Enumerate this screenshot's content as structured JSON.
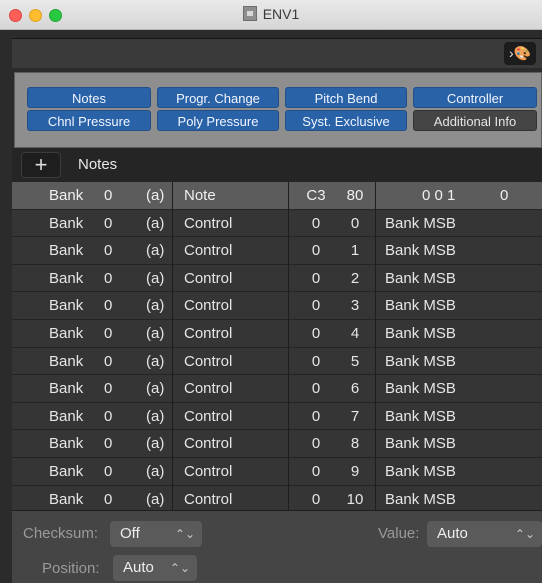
{
  "window": {
    "title": "ENV1"
  },
  "toolbar": {
    "menu_button_label": "›🎨"
  },
  "filters": {
    "buttons": [
      {
        "label": "Notes",
        "active": true
      },
      {
        "label": "Progr. Change",
        "active": true
      },
      {
        "label": "Pitch Bend",
        "active": true
      },
      {
        "label": "Controller",
        "active": true
      },
      {
        "label": "Chnl Pressure",
        "active": true
      },
      {
        "label": "Poly Pressure",
        "active": true
      },
      {
        "label": "Syst. Exclusive",
        "active": true
      },
      {
        "label": "Additional Info",
        "active": false
      }
    ]
  },
  "list": {
    "add_label": "+",
    "type_label": "Notes",
    "header_row": {
      "bank": "Bank",
      "ch": "0",
      "a": "(a)",
      "type": "Note",
      "v1": "C3",
      "v2": "80",
      "info": "0 0 1",
      "extra": "0"
    },
    "rows": [
      {
        "bank": "Bank",
        "ch": "0",
        "a": "(a)",
        "type": "Control",
        "v1": "0",
        "v2": "0",
        "info": "Bank MSB"
      },
      {
        "bank": "Bank",
        "ch": "0",
        "a": "(a)",
        "type": "Control",
        "v1": "0",
        "v2": "1",
        "info": "Bank MSB"
      },
      {
        "bank": "Bank",
        "ch": "0",
        "a": "(a)",
        "type": "Control",
        "v1": "0",
        "v2": "2",
        "info": "Bank MSB"
      },
      {
        "bank": "Bank",
        "ch": "0",
        "a": "(a)",
        "type": "Control",
        "v1": "0",
        "v2": "3",
        "info": "Bank MSB"
      },
      {
        "bank": "Bank",
        "ch": "0",
        "a": "(a)",
        "type": "Control",
        "v1": "0",
        "v2": "4",
        "info": "Bank MSB"
      },
      {
        "bank": "Bank",
        "ch": "0",
        "a": "(a)",
        "type": "Control",
        "v1": "0",
        "v2": "5",
        "info": "Bank MSB"
      },
      {
        "bank": "Bank",
        "ch": "0",
        "a": "(a)",
        "type": "Control",
        "v1": "0",
        "v2": "6",
        "info": "Bank MSB"
      },
      {
        "bank": "Bank",
        "ch": "0",
        "a": "(a)",
        "type": "Control",
        "v1": "0",
        "v2": "7",
        "info": "Bank MSB"
      },
      {
        "bank": "Bank",
        "ch": "0",
        "a": "(a)",
        "type": "Control",
        "v1": "0",
        "v2": "8",
        "info": "Bank MSB"
      },
      {
        "bank": "Bank",
        "ch": "0",
        "a": "(a)",
        "type": "Control",
        "v1": "0",
        "v2": "9",
        "info": "Bank MSB"
      },
      {
        "bank": "Bank",
        "ch": "0",
        "a": "(a)",
        "type": "Control",
        "v1": "0",
        "v2": "10",
        "info": "Bank MSB"
      }
    ]
  },
  "bottom": {
    "checksum_label": "Checksum:",
    "checksum_value": "Off",
    "value_label": "Value:",
    "value_value": "Auto",
    "position_label": "Position:",
    "position_value": "Auto",
    "stepper_glyph": "⌃⌄"
  }
}
